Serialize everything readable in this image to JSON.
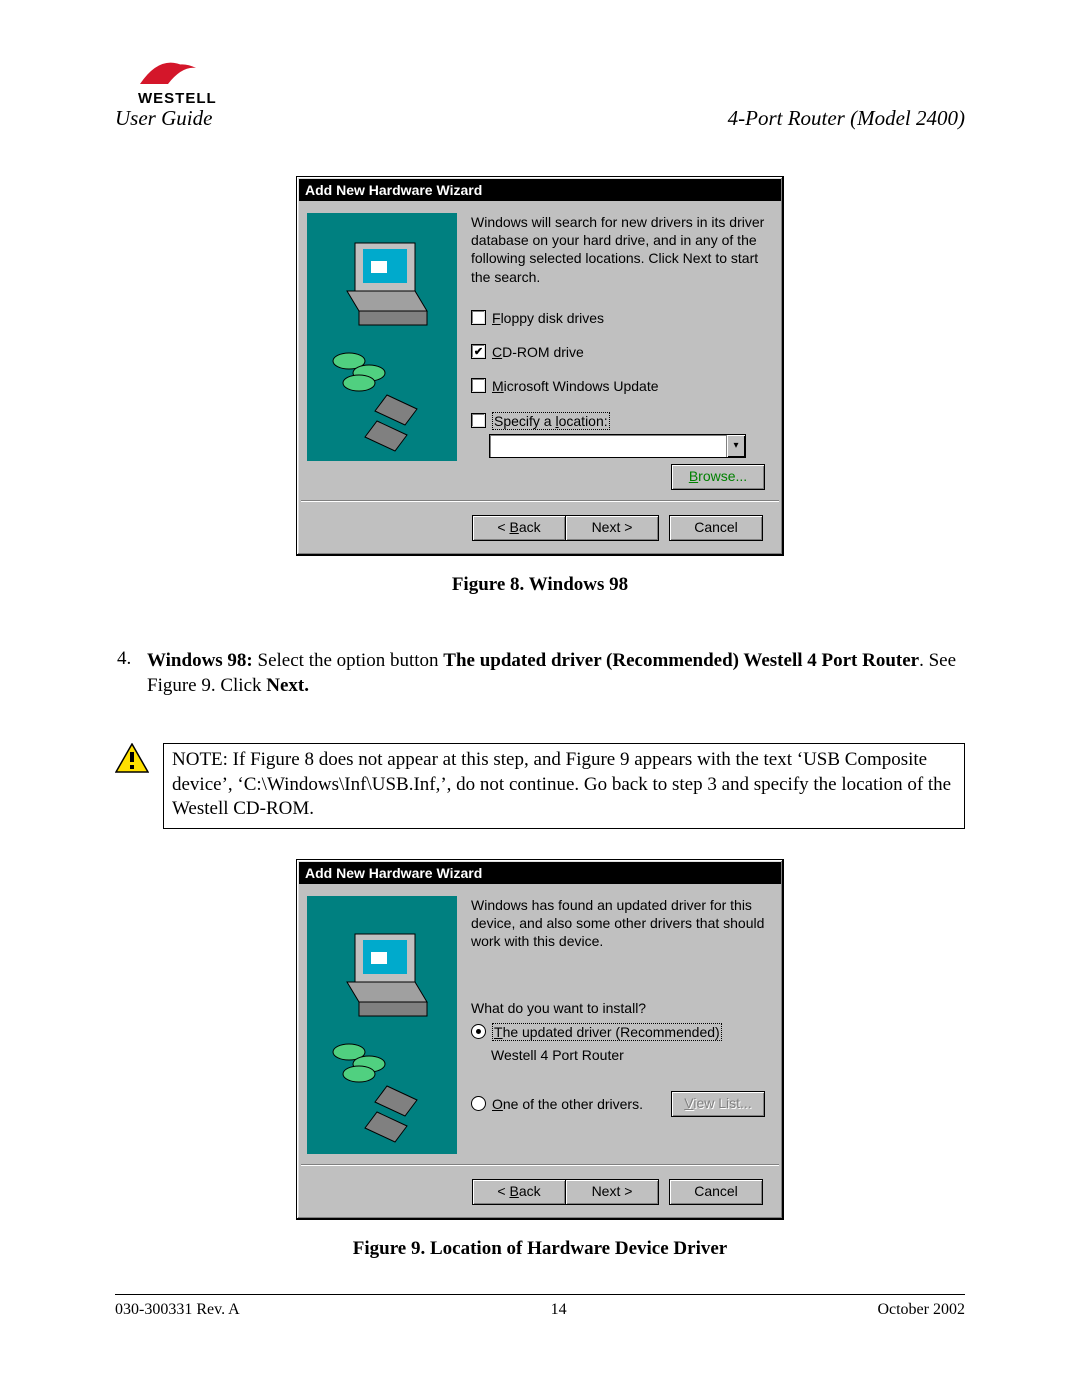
{
  "header": {
    "brand": "WESTELL",
    "left": "User Guide",
    "right": "4-Port Router (Model 2400)"
  },
  "dialog1": {
    "title": "Add New Hardware Wizard",
    "intro": "Windows will search for new drivers in its driver database on your hard drive, and in any of the following selected locations. Click Next to start the search.",
    "opt_floppy": "Floppy disk drives",
    "opt_cdrom": "CD-ROM drive",
    "opt_winupdate": "Microsoft Windows Update",
    "opt_specify": "Specify a location:",
    "browse": "Browse...",
    "back": "< Back",
    "next": "Next >",
    "cancel": "Cancel"
  },
  "caption1": "Figure 8.  Windows 98",
  "step": {
    "num": "4.",
    "prefix": "Windows 98:",
    "mid1": " Select the option button ",
    "bold1": "The updated driver (Recommended) Westell 4 Port Router",
    "mid2": ". See Figure 9. Click ",
    "bold2": "Next."
  },
  "note": "NOTE: If Figure 8 does not appear at this step, and Figure 9 appears with the text ‘USB Composite device’, ‘C:\\Windows\\Inf\\USB.Inf,’, do not continue. Go back to step 3 and specify the location of the Westell CD-ROM.",
  "dialog2": {
    "title": "Add New Hardware Wizard",
    "intro": "Windows has found an updated driver for this device, and also some other drivers that should work with this device.",
    "question": "What do you want to install?",
    "opt_updated": "The updated driver (Recommended)",
    "opt_updated_sub": "Westell 4 Port Router",
    "opt_other": "One of the other drivers.",
    "viewlist": "View List...",
    "back": "< Back",
    "next": "Next >",
    "cancel": "Cancel"
  },
  "caption2": "Figure 9.  Location of Hardware Device Driver",
  "footer": {
    "left": "030-300331 Rev. A",
    "center": "14",
    "right": "October 2002"
  }
}
